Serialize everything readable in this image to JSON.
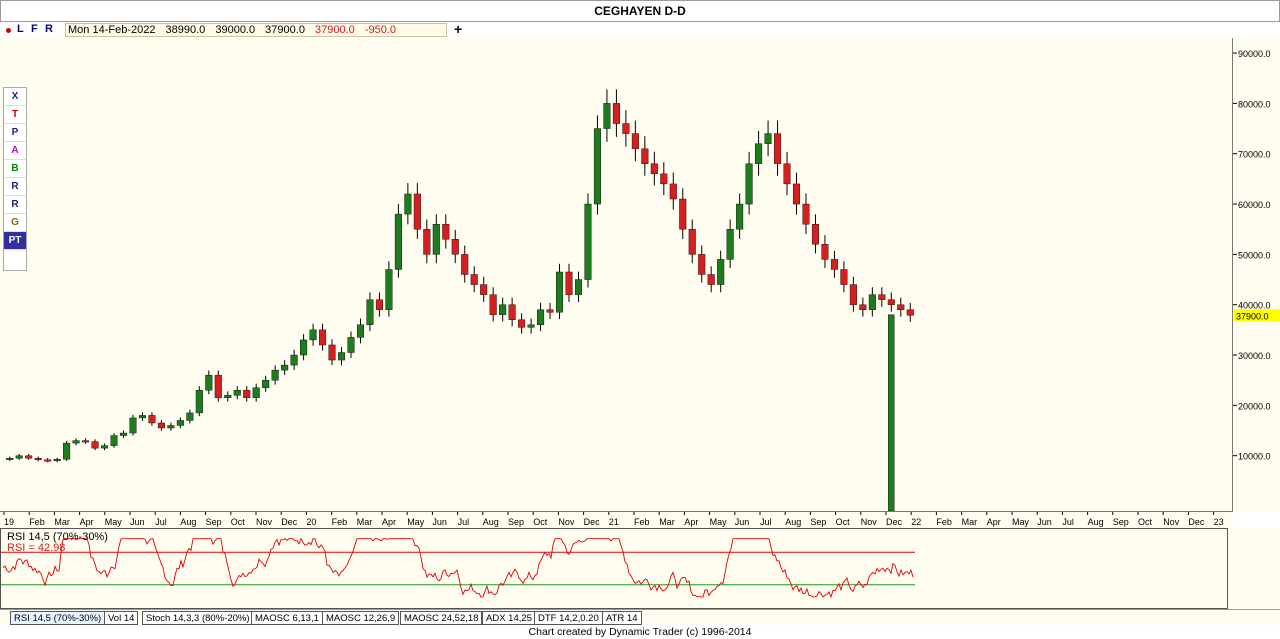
{
  "title": "CEGHAYEN D-D",
  "toolbar": {
    "letters": [
      "L",
      "F",
      "R"
    ],
    "info": {
      "date": "Mon 14-Feb-2022",
      "open": "38990.0",
      "high": "39000.0",
      "low": "37900.0",
      "close": "37900.0",
      "change": "-950.0"
    },
    "plus": "+"
  },
  "side_tools": [
    "X",
    "T",
    "P",
    "A",
    "B",
    "R",
    "R",
    "G",
    "PT"
  ],
  "colors": {
    "up": "#1e7b1e",
    "down": "#d42020",
    "background": "#fffdf0",
    "highlight": "#ffff00",
    "rsi_line": "#e00000",
    "rsi_upper": "#e00000",
    "rsi_lower": "#1e9a1e"
  },
  "price_axis": {
    "ticks": [
      "90000.0",
      "80000.0",
      "70000.0",
      "60000.0",
      "50000.0",
      "40000.0",
      "30000.0",
      "20000.0",
      "10000.0"
    ],
    "current": "37900.0"
  },
  "date_axis": {
    "labels": [
      "19",
      "Feb",
      "Mar",
      "Apr",
      "May",
      "Jun",
      "Jul",
      "Aug",
      "Sep",
      "Oct",
      "Nov",
      "Dec",
      "20",
      "Feb",
      "Mar",
      "Apr",
      "May",
      "Jun",
      "Jul",
      "Aug",
      "Sep",
      "Oct",
      "Nov",
      "Dec",
      "21",
      "Feb",
      "Mar",
      "Apr",
      "May",
      "Jun",
      "Jul",
      "Aug",
      "Sep",
      "Oct",
      "Nov",
      "Dec",
      "22",
      "Feb",
      "Mar",
      "Apr",
      "May",
      "Jun",
      "Jul",
      "Aug",
      "Sep",
      "Oct",
      "Nov",
      "Dec",
      "23"
    ]
  },
  "rsi": {
    "label1": "RSI 14,5 (70%-30%)",
    "label2": "RSI = 42.98"
  },
  "tabs": [
    "RSI 14,5 (70%-30%)",
    "Vol 14",
    "Stoch 14,3,3 (80%-20%)",
    "MAOSC 6,13,1",
    "MAOSC 12,26,9",
    "MAOSC 24,52,18",
    "ADX 14,25",
    "DTF 14,2,0.20",
    "ATR 14"
  ],
  "credits": "Chart created by Dynamic Trader  (c) 1996-2014",
  "chart_data": {
    "type": "candlestick",
    "title": "CEGHAYEN D-D",
    "ylim": [
      0,
      92000
    ],
    "y_ticks": [
      10000,
      20000,
      30000,
      40000,
      50000,
      60000,
      70000,
      80000,
      90000
    ],
    "weekly_close": [
      9500,
      10000,
      9500,
      9200,
      9000,
      9300,
      12500,
      13000,
      12800,
      11500,
      12000,
      14000,
      14500,
      17500,
      18000,
      16500,
      15500,
      16000,
      17000,
      18500,
      23000,
      26000,
      21500,
      22000,
      23000,
      21500,
      23500,
      25000,
      27000,
      28000,
      30000,
      33000,
      35000,
      32000,
      29000,
      30500,
      33500,
      36000,
      41000,
      39000,
      47000,
      58000,
      62000,
      55000,
      50000,
      56000,
      53000,
      50000,
      46000,
      44000,
      42000,
      38000,
      40000,
      37000,
      35500,
      36000,
      39000,
      38500,
      46500,
      42000,
      45000,
      60000,
      75000,
      80000,
      76000,
      74000,
      71000,
      68000,
      66000,
      64000,
      61000,
      55000,
      50000,
      46000,
      44000,
      49000,
      55000,
      60000,
      68000,
      72000,
      74000,
      68000,
      64000,
      60000,
      56000,
      52000,
      49000,
      47000,
      44000,
      40000,
      39000,
      42000,
      41000,
      40000,
      38990,
      37900
    ],
    "rsi_levels": [
      70,
      30
    ],
    "rsi_current": 42.98
  }
}
